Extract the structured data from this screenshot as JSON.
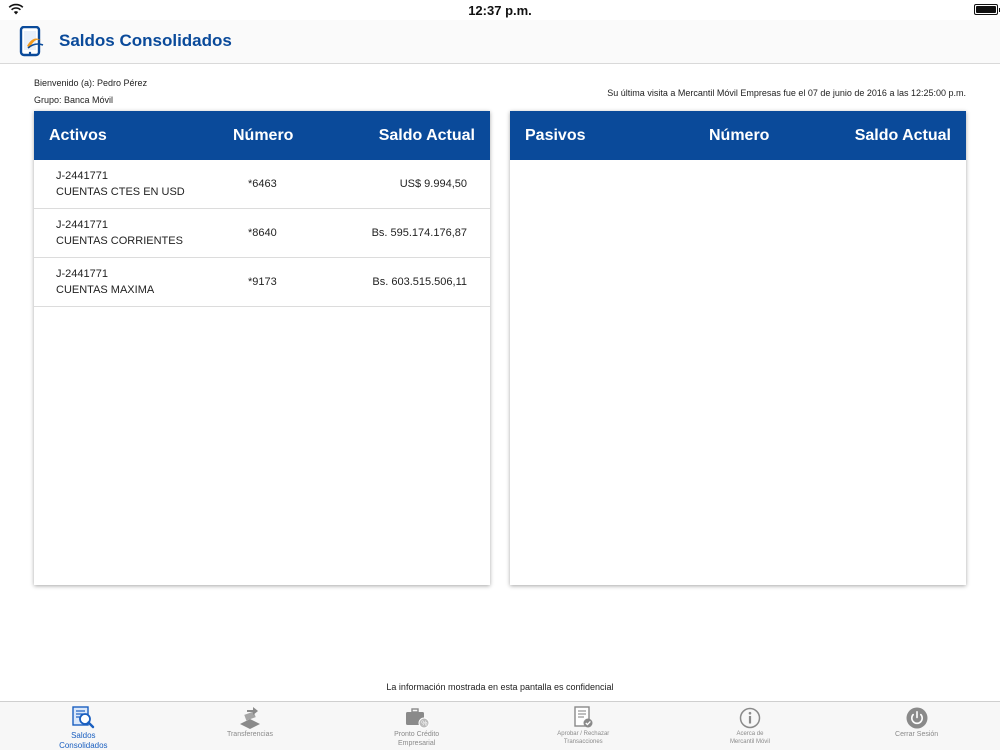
{
  "status_bar": {
    "time": "12:37 p.m."
  },
  "header": {
    "title": "Saldos Consolidados"
  },
  "info": {
    "welcome": "Bienvenido (a): Pedro Pérez",
    "group": "Grupo: Banca Móvil",
    "last_visit": "Su última visita a Mercantil Móvil Empresas fue el  07 de junio de 2016 a las 12:25:00 p.m."
  },
  "assets": {
    "headers": {
      "col1": "Activos",
      "col2": "Número",
      "col3": "Saldo Actual"
    },
    "rows": [
      {
        "id": "J-2441771",
        "name": "CUENTAS CTES EN USD",
        "number": "*6463",
        "balance": "US$ 9.994,50"
      },
      {
        "id": "J-2441771",
        "name": "CUENTAS CORRIENTES",
        "number": "*8640",
        "balance": "Bs. 595.174.176,87"
      },
      {
        "id": "J-2441771",
        "name": "CUENTAS MAXIMA",
        "number": "*9173",
        "balance": "Bs. 603.515.506,11"
      }
    ]
  },
  "liabilities": {
    "headers": {
      "col1": "Pasivos",
      "col2": "Número",
      "col3": "Saldo Actual"
    }
  },
  "footer": {
    "confidential": "La información mostrada en esta pantalla es confidencial"
  },
  "tabs": [
    {
      "label_line1": "Saldos",
      "label_line2": "Consolidados",
      "icon": "consolidated-balances-icon",
      "active": true
    },
    {
      "label_line1": "Transferencias",
      "label_line2": "",
      "icon": "transfer-icon",
      "active": false
    },
    {
      "label_line1": "Pronto Crédito",
      "label_line2": "Empresarial",
      "icon": "briefcase-credit-icon",
      "active": false
    },
    {
      "label_line1": "Aprobar / Rechazar",
      "label_line2": "Transacciones",
      "icon": "approve-document-icon",
      "active": false
    },
    {
      "label_line1": "Acerca de",
      "label_line2": "Mercantil Móvil",
      "icon": "info-icon",
      "active": false
    },
    {
      "label_line1": "Cerrar Sesión",
      "label_line2": "",
      "icon": "power-icon",
      "active": false
    }
  ],
  "colors": {
    "brand_blue": "#0a4a9a",
    "active_tab": "#1a5fc0",
    "inactive_tab": "#8a8a8a"
  }
}
